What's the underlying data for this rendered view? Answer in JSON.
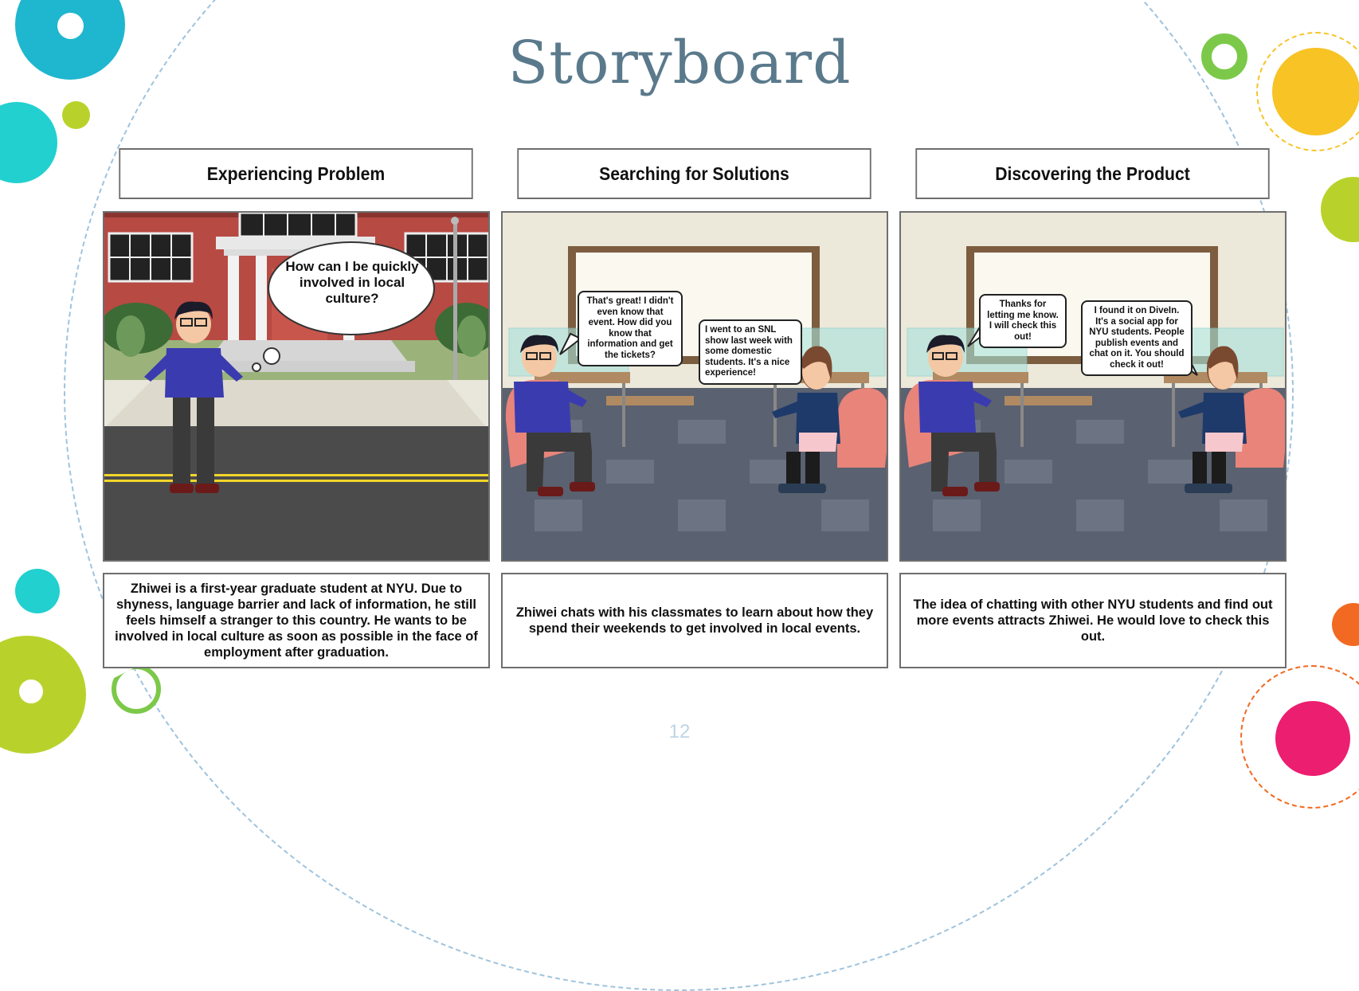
{
  "slide": {
    "title": "Storyboard",
    "page_number": "12"
  },
  "panels": [
    {
      "heading": "Experiencing Problem",
      "thought": "How can I be quickly involved in local culture?",
      "caption": "Zhiwei is a first-year graduate student at NYU. Due to shyness, language barrier and lack of information, he still feels himself a stranger to this country. He wants to be involved in local culture as soon as possible in the face of employment after graduation."
    },
    {
      "heading": "Searching for Solutions",
      "bubble_left": "That's great! I didn't even know that event. How did you know that information and get the tickets?",
      "bubble_right": "I went to an SNL show last week with some domestic students. It's a nice experience!",
      "caption": "Zhiwei chats with his classmates to learn about how they spend their weekends to get involved in local events."
    },
    {
      "heading": "Discovering the Product",
      "bubble_left": "Thanks for letting me know. I will check this out!",
      "bubble_right": "I found it on DiveIn. It's a social app for NYU students. People publish events and chat on it. You should check it out!",
      "caption": "The idea of chatting with other NYU students and find out more events attracts Zhiwei. He would love to check this out."
    }
  ],
  "colors": {
    "title": "#5a7a8c",
    "teal": "#1fb6cf",
    "cyan": "#22d0d0",
    "lime": "#b9d22b",
    "green": "#7cc94a",
    "yellow": "#f7c325",
    "orange": "#f26a22",
    "pink": "#ec1e70"
  }
}
